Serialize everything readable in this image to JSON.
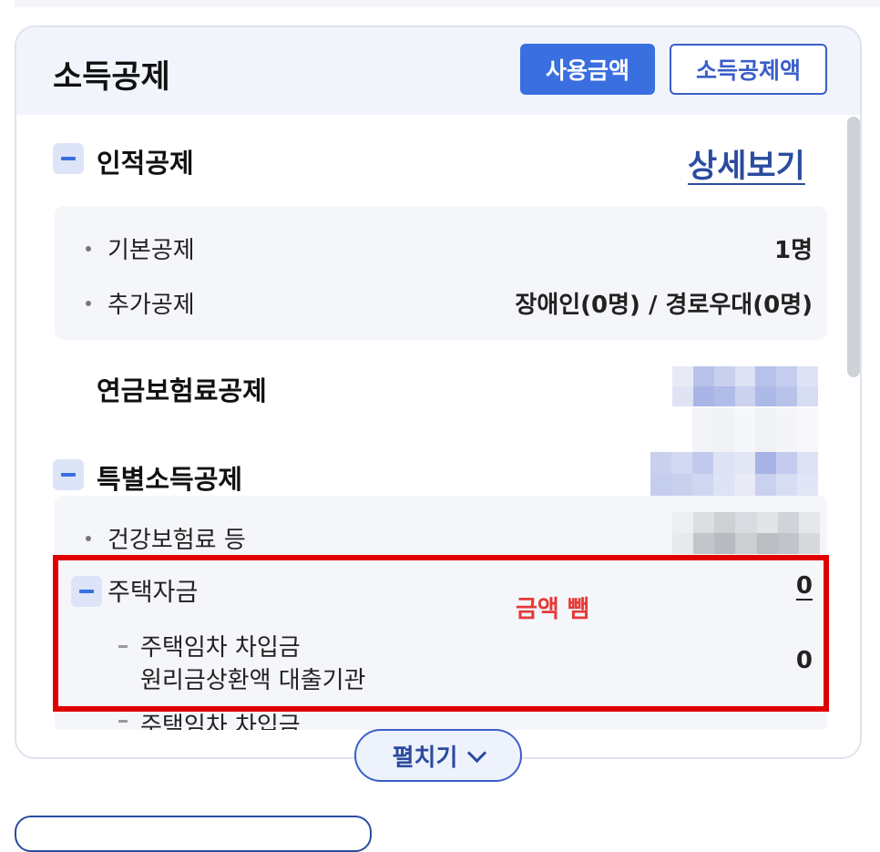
{
  "card": {
    "title": "소득공제",
    "btn_usage": "사용금액",
    "btn_deduction": "소득공제액"
  },
  "personal": {
    "label": "인적공제",
    "detail_link": "상세보기",
    "rows": [
      {
        "label": "기본공제",
        "value": "1명"
      },
      {
        "label": "추가공제",
        "value": "장애인(0명) / 경로우대(0명)"
      }
    ]
  },
  "pension": {
    "label": "연금보험료공제"
  },
  "special": {
    "label": "특별소득공제",
    "health": {
      "label": "건강보험료 등"
    },
    "housing": {
      "label": "주택자금",
      "value": "0",
      "sub": [
        {
          "label_line1": "주택임차 차입금",
          "label_line2": "원리금상환액 대출기관",
          "value": "0"
        },
        {
          "label_line1": "주택임차 차입금"
        }
      ]
    }
  },
  "annotation": "금액 뺌",
  "expand_button": "펼치기",
  "icons": {
    "collapse": "minus-icon",
    "expand": "chevron-down-icon"
  },
  "colors": {
    "accent": "#3a6fe0",
    "link": "#2a4b9e",
    "highlight": "#e00000"
  }
}
